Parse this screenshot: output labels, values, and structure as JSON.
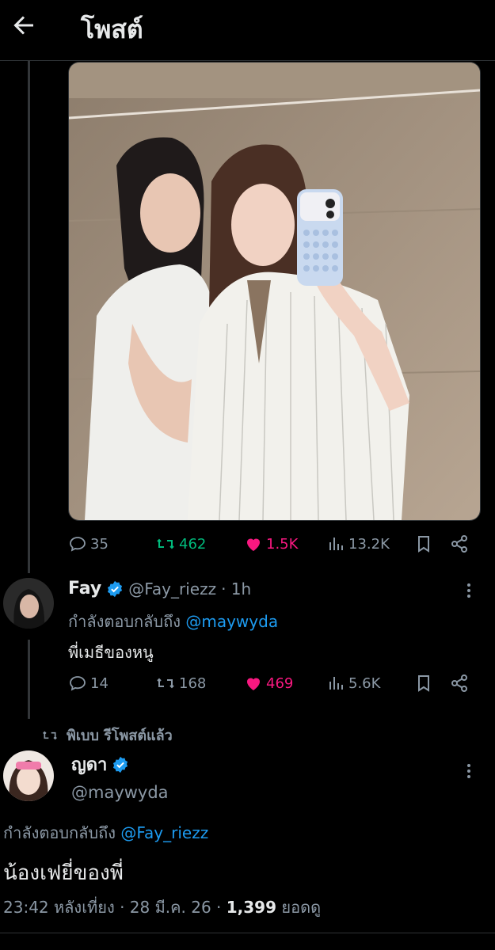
{
  "header": {
    "title": "โพสต์"
  },
  "main_post": {
    "stats": {
      "replies": "35",
      "reposts": "462",
      "likes": "1.5K",
      "views": "13.2K"
    }
  },
  "reply": {
    "name": "Fay",
    "handle": "@Fay_riezz",
    "time": "· 1h",
    "replying_prefix": "กำลังตอบกลับถึง",
    "replying_to": "@maywyda",
    "text": "พี่เมธีของหนู",
    "stats": {
      "replies": "14",
      "reposts": "168",
      "likes": "469",
      "views": "5.6K"
    }
  },
  "repost_notice": "พิเบบ รีโพสต์แล้ว",
  "focal": {
    "name": "ญดา",
    "handle": "@maywyda",
    "replying_prefix": "กำลังตอบกลับถึง",
    "replying_to": "@Fay_riezz",
    "text": "น้องเฟยี่ของพี่",
    "time": "23:42 หลังเที่ยง",
    "date": "28 มี.ค. 26",
    "views_count": "1,399",
    "views_label": "ยอดดู"
  },
  "colors": {
    "accent": "#1d9bf0",
    "like": "#f91880",
    "repost": "#00ba7c",
    "muted": "#8b98a5"
  },
  "icons": [
    "back-arrow-icon",
    "reply-icon",
    "repost-icon",
    "like-icon",
    "views-icon",
    "bookmark-icon",
    "share-icon",
    "verified-icon",
    "more-icon"
  ]
}
